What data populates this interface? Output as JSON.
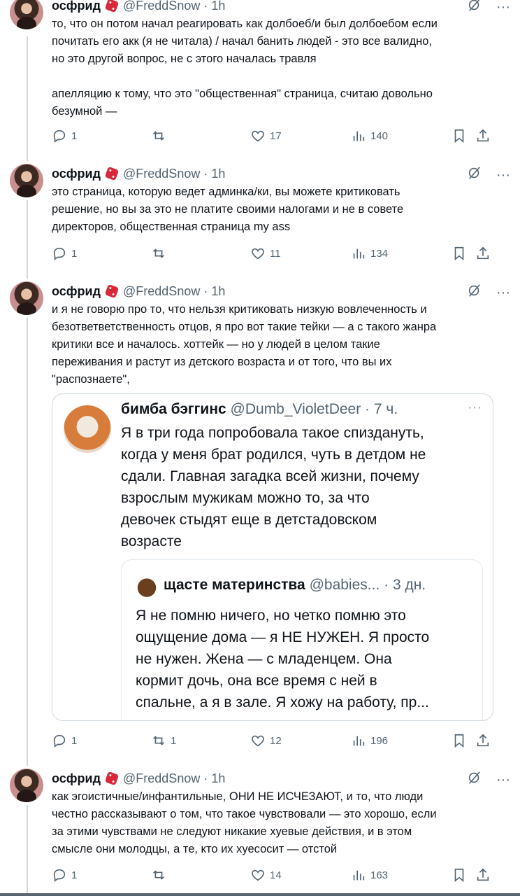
{
  "tweets": [
    {
      "name": "осфрид",
      "handle": "@FreddSnow · 1h",
      "text": "то, что он потом начал реагировать как долбоеб/и был долбоебом если\nпочитать его акк (я не читала) / начал банить людей - это все валидно,\nно это другой вопрос, не с этого началась травля\n\nапелляцию к тому, что это \"общественная\" страница, считаю довольно\nбезумной —",
      "stats": {
        "replies": "1",
        "reposts": "",
        "likes": "17",
        "views": "140"
      }
    },
    {
      "name": "осфрид",
      "handle": "@FreddSnow · 1h",
      "text": "это страница, которую ведет админка/ки, вы можете критиковать\nрешение, но вы за это не платите своими налогами и не в совете\nдиректоров, общественная страница my ass",
      "stats": {
        "replies": "1",
        "reposts": "",
        "likes": "11",
        "views": "134"
      }
    },
    {
      "name": "осфрид",
      "handle": "@FreddSnow · 1h",
      "text": "и я не говорю про то, что нельзя критиковать низкую вовлеченность и\nбезответветственность отцов, я про вот такие тейки — а с такого жанра\nкритики все и началось. хоттейк — но у людей в целом такие\nпереживания и растут из детского возраста и от того, что вы их\n\"распознаете\",",
      "quote": {
        "name": "бимба бэггинс",
        "handle": "@Dumb_VioletDeer · 7 ч.",
        "text": "Я в три года попробовала такое спиздануть,\nкогда у меня брат родился, чуть в детдом не\nсдали. Главная загадка всей жизни, почему\nвзрослым мужикам можно то, за что\nдевочек стыдят еще в детстадовском\nвозрасте",
        "inner": {
          "name": "щасте материнства",
          "handle": "@babies... · 3 дн.",
          "text": "Я не помню ничего, но четко помню это\nощущение дома — я НЕ НУЖЕН. Я просто\nне нужен. Жена — с младенцем. Она\nкормит дочь, она все время с ней в\nспальне, а я в зале. Я хожу на работу, пр..."
        }
      },
      "stats": {
        "replies": "1",
        "reposts": "1",
        "likes": "12",
        "views": "196"
      }
    },
    {
      "name": "осфрид",
      "handle": "@FreddSnow · 1h",
      "text": "как эгоистичные/инфантильные, ОНИ НЕ ИСЧЕЗАЮТ, и то, что люди\nчестно рассказывают о том, что такое чувствовали — это хорошо, если\nза этими чувствами не следуют никакие хуевые действия, и в этом\nсмысле они молодцы, а те, кто их хуесосит — отстой",
      "stats": {
        "replies": "1",
        "reposts": "",
        "likes": "14",
        "views": "163"
      }
    }
  ],
  "icons": {
    "more": "···",
    "grok": "grok-icon"
  }
}
